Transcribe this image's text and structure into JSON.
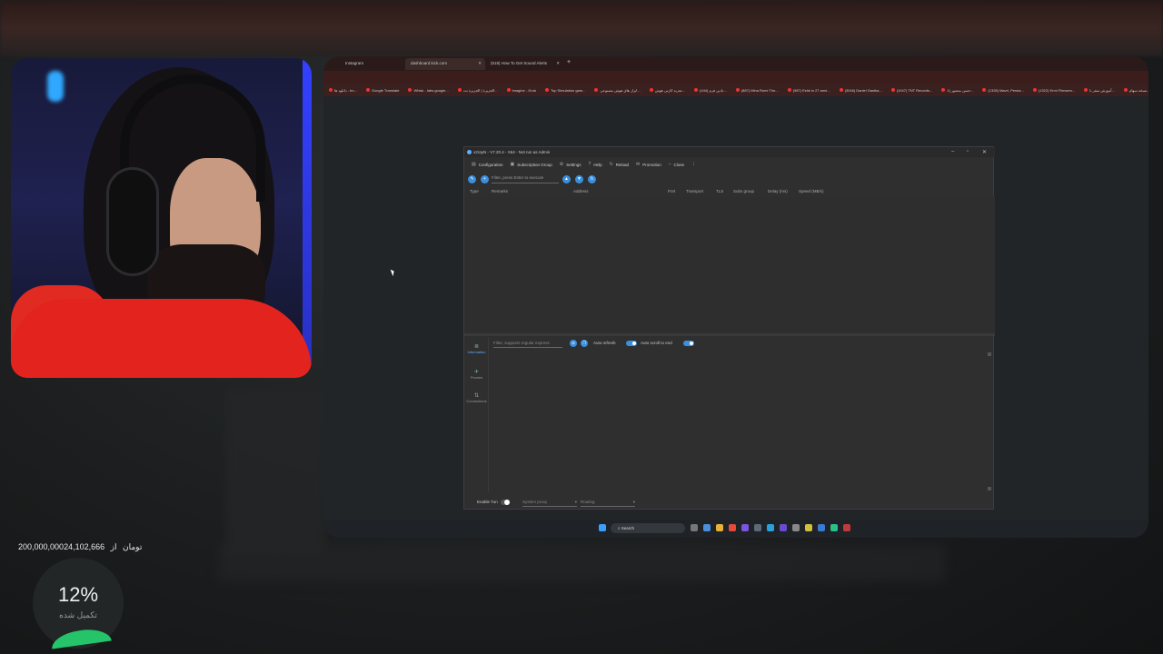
{
  "browser": {
    "tabs": [
      {
        "label": "Instagram",
        "active": false
      },
      {
        "label": "dashboard.kick.com",
        "active": true
      },
      {
        "label": "(518) How To Get Sound Alerts",
        "active": false
      }
    ],
    "bookmarks": [
      "دانلود ها - bo...",
      "Google Translate",
      "Whisk - labs.google...",
      "الجزیرة | الجزیرة نت...",
      "Imagine - Grok",
      "Top Simulation gam...",
      "ابزار های هوش مصنوعی...",
      "تجربه کارتی هوش...",
      "(444) نادین فرم...",
      "(887) Mina Rumi The...",
      "(987) Eshk is 27 anni...",
      "(3046) Daniel Gastka...",
      "(1047) TNT Records...",
      "حسن منصور (1...",
      "(1328) Mavri, Persia...",
      "(1322) Ermi Filmsem...",
      "آموزش سفر با...",
      "این بازی نسخه سهام..."
    ]
  },
  "app": {
    "title": "v2rayN - V7.20.4 - X64 - Not run as Admin",
    "menu": [
      {
        "icon": "configuration-icon",
        "label": "Configuration"
      },
      {
        "icon": "subscription-icon",
        "label": "Subscription Group"
      },
      {
        "icon": "gear-icon",
        "label": "Settings"
      },
      {
        "icon": "help-icon",
        "label": "Help"
      },
      {
        "icon": "reload-icon",
        "label": "Reload"
      },
      {
        "icon": "promotion-icon",
        "label": "Promotion"
      },
      {
        "icon": "minus-icon",
        "label": "Close"
      }
    ],
    "filter_placeholder": "Filter, press Enter to execute",
    "columns": [
      "Type",
      "Remarks",
      "Address",
      "Port",
      "Transport",
      "TLS",
      "Subs group",
      "Delay (ms)",
      "Speed (MB/s)"
    ],
    "rail": [
      {
        "label": "Information",
        "active": true
      },
      {
        "label": "Proxies",
        "active": false
      },
      {
        "label": "Connections",
        "active": false
      }
    ],
    "log_filter_placeholder": "Filter, supports regular express",
    "auto_refresh_label": "Auto refresh",
    "auto_scroll_label": "Auto scroll to end",
    "status": {
      "enable_tun_label": "Enable Tun",
      "system_proxy_label": "System proxy",
      "routing_label": "Routing"
    }
  },
  "taskbar": {
    "search_label": "Search"
  },
  "donation": {
    "current": "24,102,666",
    "separator": "از",
    "goal": "200,000,000تومان",
    "percent": "12%",
    "percent_value": 12,
    "sub_label": "تکمیل شده",
    "accent": "#25c46a"
  }
}
